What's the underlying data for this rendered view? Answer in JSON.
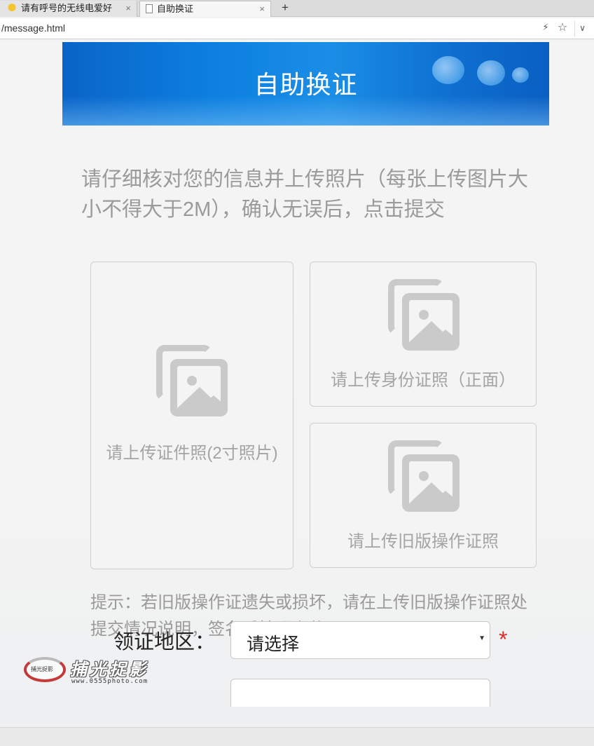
{
  "browser": {
    "tabs": [
      {
        "title": "请有呼号的无线电爱好",
        "active": false
      },
      {
        "title": "自助换证",
        "active": true
      }
    ],
    "new_tab_label": "+",
    "close_glyph": "×",
    "url": "/message.html",
    "icons": {
      "bolt": "lightning-icon",
      "star": "bookmark-star-icon",
      "dropdown": "chevron-down-icon"
    }
  },
  "banner": {
    "title": "自助换证"
  },
  "intro_text": "请仔细核对您的信息并上传照片（每张上传图片大小不得大于2M），确认无误后，点击提交",
  "uploads": {
    "main": {
      "label": "请上传证件照(2寸照片)",
      "icon": "image-upload-icon"
    },
    "id_front": {
      "label": "请上传身份证照（正面）",
      "icon": "image-upload-icon"
    },
    "old_license": {
      "label": "请上传旧版操作证照",
      "icon": "image-upload-icon"
    }
  },
  "hint_text": "提示：若旧版操作证遗失或损坏，请在上传旧版操作证照处提交情况说明，签名后拍照上传。",
  "form": {
    "region_label": "领证地区：",
    "region_value": "请选择",
    "required_mark": "*"
  },
  "watermark": {
    "logo_text": "捕光捉影",
    "brand": "捕光捉影",
    "url": "www.0555photo.com"
  },
  "colors": {
    "banner_blue": "#0c7fe0",
    "required_red": "#e42a2a",
    "muted_text": "#9a9a9a"
  }
}
